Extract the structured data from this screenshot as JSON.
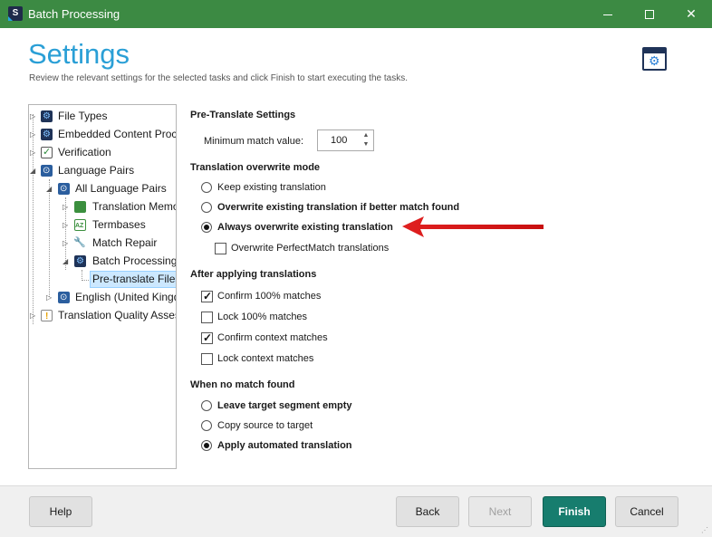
{
  "window": {
    "title": "Batch Processing",
    "app_icon_letter": "S"
  },
  "header": {
    "title": "Settings",
    "subtitle": "Review the relevant settings for the selected tasks and click Finish to start executing the tasks."
  },
  "tree": {
    "items": [
      {
        "label": "File Types",
        "icon": "settings-icon"
      },
      {
        "label": "Embedded Content Proc",
        "icon": "settings-icon"
      },
      {
        "label": "Verification",
        "icon": "checklist-icon"
      },
      {
        "label": "Language Pairs",
        "icon": "language-icon"
      },
      {
        "label": "All Language Pairs",
        "icon": "language-icon"
      },
      {
        "label": "Translation Memo",
        "icon": "translation-memory-icon"
      },
      {
        "label": "Termbases",
        "icon": "termbase-icon"
      },
      {
        "label": "Match Repair",
        "icon": "wrench-icon"
      },
      {
        "label": "Batch Processing",
        "icon": "settings-icon"
      },
      {
        "label": "Pre-translate Files",
        "icon": ""
      },
      {
        "label": "English (United Kingd",
        "icon": "language-icon"
      },
      {
        "label": "Translation Quality Assess",
        "icon": "quality-assessment-icon"
      }
    ]
  },
  "pretranslate": {
    "heading": "Pre-Translate Settings",
    "min_match_label": "Minimum match value:",
    "min_match_value": "100"
  },
  "overwrite_mode": {
    "heading": "Translation overwrite mode",
    "options": [
      {
        "label": "Keep existing translation",
        "selected": false
      },
      {
        "label": "Overwrite existing translation if better match found",
        "selected": false
      },
      {
        "label": "Always overwrite existing translation",
        "selected": true
      }
    ],
    "perfectmatch_label": "Overwrite PerfectMatch translations",
    "perfectmatch_checked": false
  },
  "after_applying": {
    "heading": "After applying translations",
    "options": [
      {
        "label": "Confirm 100% matches",
        "checked": true
      },
      {
        "label": "Lock 100% matches",
        "checked": false
      },
      {
        "label": "Confirm context matches",
        "checked": true
      },
      {
        "label": "Lock context matches",
        "checked": false
      }
    ]
  },
  "no_match": {
    "heading": "When no match found",
    "options": [
      {
        "label": "Leave target segment empty",
        "selected": false
      },
      {
        "label": "Copy source to target",
        "selected": false
      },
      {
        "label": "Apply automated translation",
        "selected": true
      }
    ]
  },
  "footer": {
    "help": "Help",
    "back": "Back",
    "next": "Next",
    "finish": "Finish",
    "cancel": "Cancel"
  },
  "colors": {
    "titlebar": "#3c8a43",
    "accent_title": "#2a9fd6",
    "finish_button": "#177d6e",
    "arrow": "#e02020"
  }
}
